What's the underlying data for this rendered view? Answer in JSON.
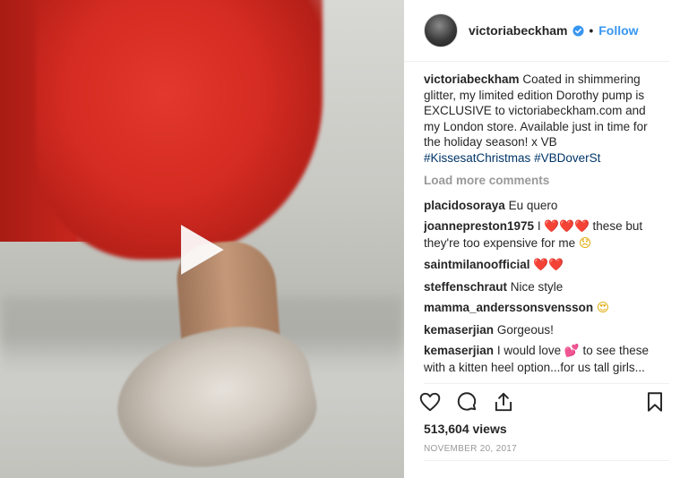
{
  "header": {
    "username": "victoriabeckham",
    "separator": "•",
    "follow_label": "Follow"
  },
  "caption": {
    "username": "victoriabeckham",
    "text": "Coated in shimmering glitter, my limited edition Dorothy pump is EXCLUSIVE to victoriabeckham.com and my London store. Available just in time for the holiday season! x VB",
    "hashtags": [
      "#KissesatChristmas",
      "#VBDoverSt"
    ]
  },
  "load_more": "Load more comments",
  "comments": [
    {
      "username": "placidosoraya",
      "text_before": "Eu quero",
      "emoji": "",
      "text_after": ""
    },
    {
      "username": "joannepreston1975",
      "text_before": "I",
      "emoji": "❤️❤️❤️",
      "text_after": "these but they're too expensive for me",
      "emoji2": "😞"
    },
    {
      "username": "saintmilanoofficial",
      "text_before": "",
      "emoji": "❤️❤️",
      "text_after": ""
    },
    {
      "username": "steffenschraut",
      "text_before": "Nice style",
      "emoji": "",
      "text_after": ""
    },
    {
      "username": "mamma_anderssonsvensson",
      "text_before": "",
      "emoji": "😍",
      "text_after": ""
    },
    {
      "username": "kemaserjian",
      "text_before": "Gorgeous!",
      "emoji": "",
      "text_after": ""
    },
    {
      "username": "kemaserjian",
      "text_before": "I would love",
      "emoji": "💕",
      "text_after": "to see these with a kitten heel option...for us tall girls..."
    }
  ],
  "views": "513,604 views",
  "date": "NOVEMBER 20, 2017",
  "icons": {
    "play": "play-icon",
    "like": "heart-icon",
    "comment": "comment-bubble-icon",
    "share": "share-icon",
    "save": "bookmark-icon",
    "verified": "verified-badge-icon"
  },
  "colors": {
    "follow": "#3897f0",
    "hashtag": "#003569",
    "muted": "#999999",
    "text": "#262626"
  }
}
